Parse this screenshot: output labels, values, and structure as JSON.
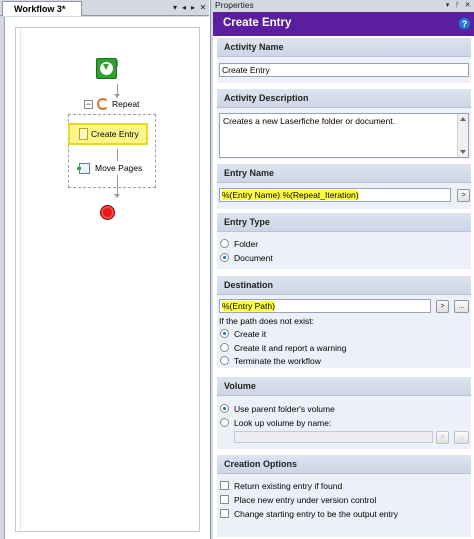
{
  "workflow_tab": {
    "title": "Workflow 3*",
    "controls": [
      "▾",
      "◂",
      "▸",
      "✕"
    ]
  },
  "designer": {
    "repeat_label": "Repeat",
    "create_entry_label": "Create Entry",
    "move_pages_label": "Move Pages"
  },
  "properties": {
    "pane_title": "Properties",
    "controls": [
      "▾",
      "ᚹ",
      "✕"
    ],
    "header_title": "Create Entry",
    "help_glyph": "?",
    "sections": {
      "activity_name": {
        "heading": "Activity Name",
        "value": "Create Entry"
      },
      "activity_description": {
        "heading": "Activity Description",
        "value": "Creates a new Laserfiche folder or document."
      },
      "entry_name": {
        "heading": "Entry Name",
        "value": "%(Entry Name) %(Repeat_Iteration)",
        "button": ">"
      },
      "entry_type": {
        "heading": "Entry Type",
        "options": [
          "Folder",
          "Document"
        ],
        "selected": "Document"
      },
      "destination": {
        "heading": "Destination",
        "value": "%(Entry Path)",
        "buttons": [
          ">",
          "..."
        ],
        "if_not_exist_label": "If the path does not exist:",
        "options": [
          "Create it",
          "Create it and report a warning",
          "Terminate the workflow"
        ],
        "selected": "Create it"
      },
      "volume": {
        "heading": "Volume",
        "options": [
          "Use parent folder's volume",
          "Look up volume by name:"
        ],
        "selected": "Use parent folder's volume",
        "buttons": [
          ">",
          "..."
        ]
      },
      "creation_options": {
        "heading": "Creation Options",
        "checkboxes": [
          {
            "label": "Return existing entry if found",
            "checked": false
          },
          {
            "label": "Place new entry under version control",
            "checked": false
          },
          {
            "label": "Change starting entry to be the output entry",
            "checked": false
          }
        ]
      }
    }
  },
  "colors": {
    "header_bg": "#5a1e9e",
    "highlight": "#ffff3c",
    "start_green": "#2ea12e",
    "end_red": "#e31a1a"
  },
  "icons": {
    "start": "start-icon",
    "repeat": "repeat-icon",
    "create_entry": "document-icon",
    "move_pages": "move-pages-icon",
    "end": "end-icon",
    "help": "help-icon"
  }
}
